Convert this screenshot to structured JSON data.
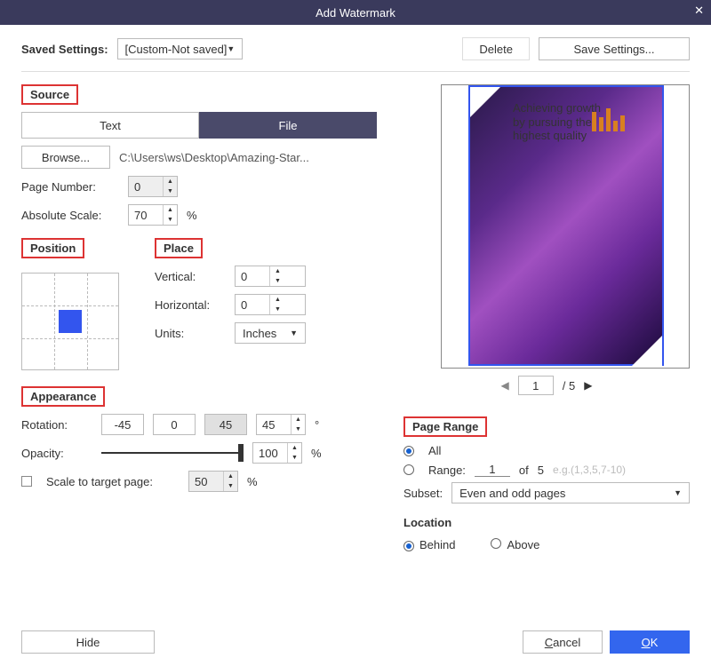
{
  "title": "Add Watermark",
  "saved": {
    "label": "Saved Settings:",
    "value": "[Custom-Not saved]",
    "delete": "Delete",
    "save": "Save Settings..."
  },
  "sections": {
    "source": "Source",
    "position": "Position",
    "place": "Place",
    "appearance": "Appearance",
    "pagerange": "Page Range",
    "location": "Location"
  },
  "source": {
    "tab_text": "Text",
    "tab_file": "File",
    "browse": "Browse...",
    "path": "C:\\Users\\ws\\Desktop\\Amazing-Star...",
    "pagenum_label": "Page Number:",
    "pagenum": "0",
    "scale_label": "Absolute Scale:",
    "scale": "70",
    "pct": "%"
  },
  "place": {
    "vert_label": "Vertical:",
    "vert": "0",
    "horiz_label": "Horizontal:",
    "horiz": "0",
    "units_label": "Units:",
    "units": "Inches"
  },
  "appearance": {
    "rotation_label": "Rotation:",
    "r_n45": "-45",
    "r_0": "0",
    "r_45": "45",
    "r_val": "45",
    "deg": "°",
    "opacity_label": "Opacity:",
    "opacity": "100",
    "pct": "%",
    "scale_target_label": "Scale to target page:",
    "scale_target": "50"
  },
  "preview": {
    "current": "1",
    "total": "/ 5",
    "headline1": "Achieving growth",
    "headline2": "by pursuing the",
    "headline3": "highest quality"
  },
  "pagerange": {
    "all": "All",
    "range_label": "Range:",
    "range_from": "1",
    "of": "of",
    "range_total": "5",
    "hint": "e.g.(1,3,5,7-10)",
    "subset_label": "Subset:",
    "subset": "Even and odd pages"
  },
  "location": {
    "behind": "Behind",
    "above": "Above"
  },
  "footer": {
    "hide": "Hide",
    "cancel": "Cancel",
    "ok": "OK",
    "cancel_u": "C",
    "ok_u": "O"
  }
}
